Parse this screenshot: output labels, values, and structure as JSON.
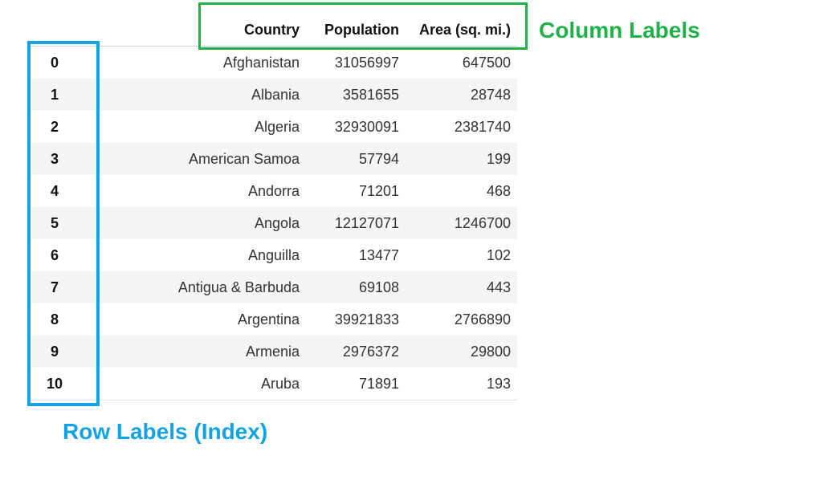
{
  "table": {
    "columns": [
      "Country",
      "Population",
      "Area (sq. mi.)"
    ],
    "rows": [
      {
        "index": "0",
        "country": "Afghanistan",
        "population": "31056997",
        "area": "647500"
      },
      {
        "index": "1",
        "country": "Albania",
        "population": "3581655",
        "area": "28748"
      },
      {
        "index": "2",
        "country": "Algeria",
        "population": "32930091",
        "area": "2381740"
      },
      {
        "index": "3",
        "country": "American Samoa",
        "population": "57794",
        "area": "199"
      },
      {
        "index": "4",
        "country": "Andorra",
        "population": "71201",
        "area": "468"
      },
      {
        "index": "5",
        "country": "Angola",
        "population": "12127071",
        "area": "1246700"
      },
      {
        "index": "6",
        "country": "Anguilla",
        "population": "13477",
        "area": "102"
      },
      {
        "index": "7",
        "country": "Antigua & Barbuda",
        "population": "69108",
        "area": "443"
      },
      {
        "index": "8",
        "country": "Argentina",
        "population": "39921833",
        "area": "2766890"
      },
      {
        "index": "9",
        "country": "Armenia",
        "population": "2976372",
        "area": "29800"
      },
      {
        "index": "10",
        "country": "Aruba",
        "population": "71891",
        "area": "193"
      }
    ]
  },
  "annotations": {
    "column_labels": "Column Labels",
    "row_labels": "Row Labels (Index)",
    "column_color": "#22b04b",
    "row_color": "#13a2e3"
  }
}
